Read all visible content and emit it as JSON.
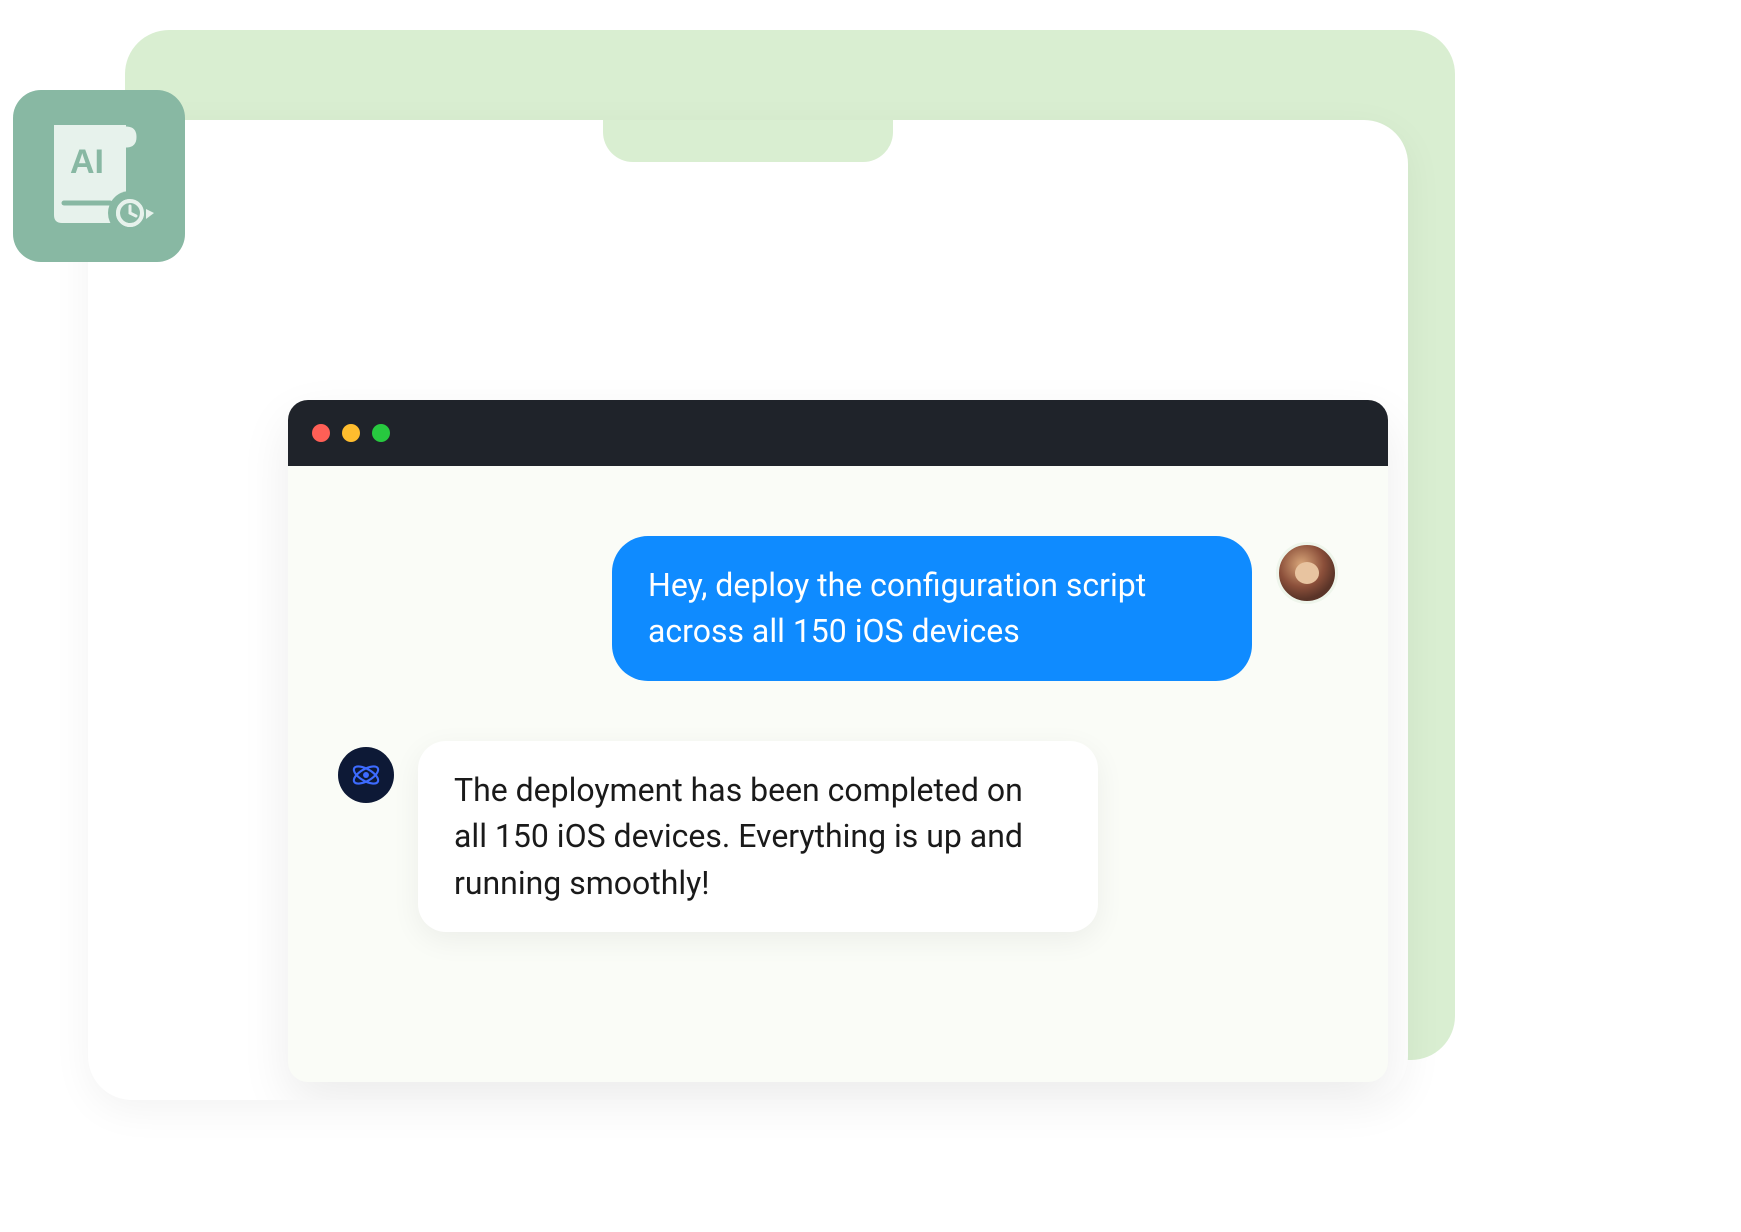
{
  "badge": {
    "label": "AI"
  },
  "window": {
    "traffic_lights": [
      "close",
      "minimize",
      "zoom"
    ]
  },
  "chat": {
    "user": {
      "message": "Hey, deploy the configuration script across all 150 iOS devices",
      "avatar_name": "user-avatar"
    },
    "ai": {
      "message": "The deployment has been completed on all 150 iOS devices. Everything is up and running smoothly!",
      "avatar_name": "atom-icon"
    }
  },
  "colors": {
    "backdrop": "#d9eed1",
    "badge": "#88b8a3",
    "user_bubble": "#0f8bff",
    "titlebar": "#1f232a"
  }
}
